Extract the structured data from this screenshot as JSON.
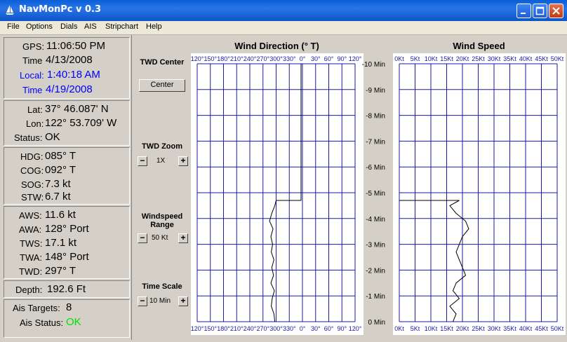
{
  "window": {
    "title": "NavMonPc v 0.3"
  },
  "menu": [
    "File",
    "Options",
    "Dials",
    "AIS",
    "Stripchart",
    "Help"
  ],
  "time_section": {
    "gps_label": "GPS:",
    "gps_value": "11:06:50 PM",
    "time_label": "Time",
    "time_value": "4/13/2008",
    "local_label": "Local:",
    "local_value": "1:40:18 AM",
    "time2_label": "Time",
    "time2_value": "4/19/2008"
  },
  "position_section": {
    "lat_label": "Lat:",
    "lat_value": "37° 46.087' N",
    "lon_label": "Lon:",
    "lon_value": "122° 53.709' W",
    "status_label": "Status:",
    "status_value": "OK"
  },
  "heading_section": {
    "hdg_label": "HDG:",
    "hdg_value": "085° T",
    "cog_label": "COG:",
    "cog_value": "092° T",
    "sog_label": "SOG:",
    "sog_value": "7.3 kt",
    "stw_label": "STW:",
    "stw_value": "6.7 kt"
  },
  "wind_section": {
    "aws_label": "AWS:",
    "aws_value": "11.6 kt",
    "awa_label": "AWA:",
    "awa_value": "128° Port",
    "tws_label": "TWS:",
    "tws_value": "17.1 kt",
    "twa_label": "TWA:",
    "twa_value": "148° Port",
    "twd_label": "TWD:",
    "twd_value": "297° T"
  },
  "depth_section": {
    "depth_label": "Depth:",
    "depth_value": "192.6 Ft"
  },
  "ais_section": {
    "targets_label": "Ais Targets:",
    "targets_value": "8",
    "status_label": "Ais Status:",
    "status_value": "OK"
  },
  "controls": {
    "twd_center_title": "TWD Center",
    "center_button": "Center",
    "twd_zoom_title": "TWD Zoom",
    "twd_zoom_value": "1X",
    "windspeed_range_title": "Windspeed Range",
    "windspeed_range_value": "50 Kt",
    "time_scale_title": "Time Scale",
    "time_scale_value": "10 Min",
    "minus": "−",
    "plus": "+"
  },
  "chart_data": [
    {
      "type": "line",
      "title": "Wind Direction (° T)",
      "x_ticks": [
        "120°",
        "150°",
        "180°",
        "210°",
        "240°",
        "270°",
        "300°",
        "330°",
        "0°",
        "30°",
        "60°",
        "90°",
        "120°"
      ],
      "y_ticks": [
        "-10 Min",
        "-9 Min",
        "-8 Min",
        "-7 Min",
        "-6 Min",
        "-5 Min",
        "-4 Min",
        "-3 Min",
        "-2 Min",
        "-1 Min",
        "0 Min"
      ],
      "grid": true,
      "current_value": 297,
      "series": [
        {
          "time_min": [
            -4.7,
            -4.5,
            -4.2,
            -3.9,
            -3.6,
            -3.3,
            -3.0,
            -2.7,
            -2.4,
            -2.1,
            -1.8,
            -1.5,
            -1.2,
            -0.9,
            -0.6,
            -0.3,
            0.0
          ],
          "values": [
            300,
            297,
            290,
            285,
            293,
            288,
            292,
            289,
            295,
            290,
            294,
            288,
            296,
            291,
            289,
            295,
            297
          ]
        }
      ]
    },
    {
      "type": "line",
      "title": "Wind Speed",
      "x_ticks": [
        "0Kt",
        "5Kt",
        "10Kt",
        "15Kt",
        "20Kt",
        "25Kt",
        "30Kt",
        "35Kt",
        "40Kt",
        "45Kt",
        "50Kt"
      ],
      "grid": true,
      "xlim": [
        0,
        50
      ],
      "current_value": 17.1,
      "series": [
        {
          "time_min": [
            -4.7,
            -4.5,
            -4.2,
            -3.9,
            -3.6,
            -3.3,
            -3.0,
            -2.7,
            -2.4,
            -2.1,
            -1.8,
            -1.5,
            -1.2,
            -0.9,
            -0.6,
            -0.3,
            0.0
          ],
          "values": [
            19,
            16,
            18,
            21,
            22,
            20,
            19,
            18,
            19,
            20,
            21,
            18,
            17,
            19,
            16,
            18,
            17
          ]
        }
      ]
    }
  ]
}
